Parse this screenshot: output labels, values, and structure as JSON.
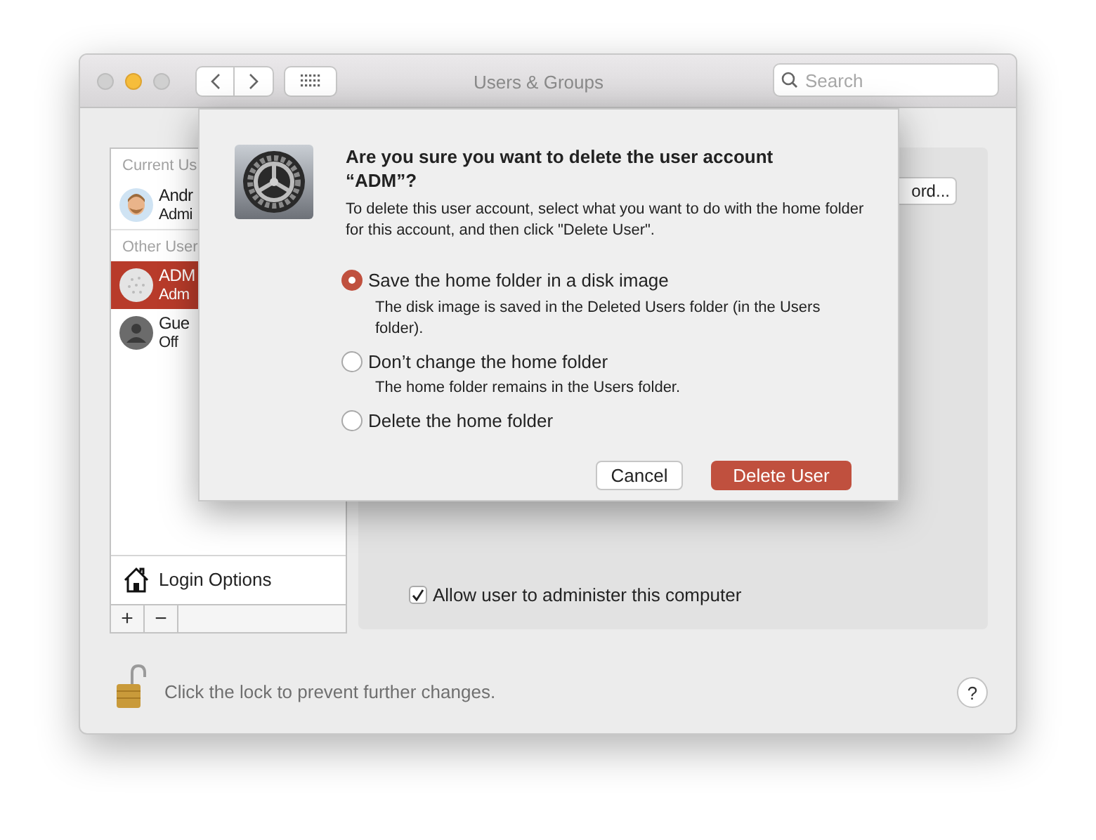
{
  "window": {
    "title": "Users & Groups"
  },
  "search": {
    "placeholder": "Search"
  },
  "sidebar": {
    "sections": [
      {
        "header": "Current Us",
        "users": [
          {
            "name": "Andr",
            "role": "Admi",
            "selected": false,
            "kind": "memoji"
          }
        ]
      },
      {
        "header": "Other User",
        "users": [
          {
            "name": "ADM",
            "role": "Adm",
            "selected": true,
            "kind": "golf"
          },
          {
            "name": "Gue",
            "role": "Off",
            "selected": false,
            "kind": "person"
          }
        ]
      }
    ],
    "login_options": "Login Options",
    "add_button": "+",
    "remove_button": "−"
  },
  "panel": {
    "password_button": "ord...",
    "allow_admin": {
      "label": "Allow user to administer this computer",
      "checked": true
    }
  },
  "lock_text": "Click the lock to prevent further changes.",
  "help_button": "?",
  "dialog": {
    "title": "Are you sure you want to delete the user account “ADM”?",
    "message": "To delete this user account, select what you want to do with the home folder for this account, and then click \"Delete User\".",
    "options": [
      {
        "label": "Save the home folder in a disk image",
        "description": "The disk image is saved in the Deleted Users folder (in the Users folder).",
        "selected": true
      },
      {
        "label": "Don’t change the home folder",
        "description": "The home folder remains in the Users folder.",
        "selected": false
      },
      {
        "label": "Delete the home folder",
        "selected": false
      }
    ],
    "buttons": [
      {
        "label": "Cancel",
        "kind": "secondary"
      },
      {
        "label": "Delete User",
        "kind": "primary"
      }
    ]
  }
}
